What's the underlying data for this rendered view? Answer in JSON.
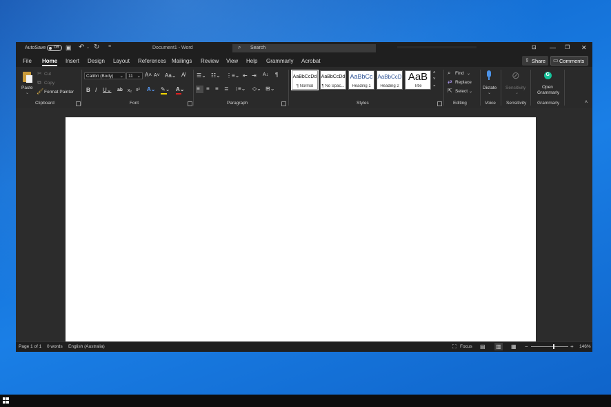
{
  "titlebar": {
    "autosave_label": "AutoSave",
    "autosave_state": "Off",
    "doc_title": "Document1 - Word",
    "search_placeholder": "Search"
  },
  "tabs": [
    "File",
    "Home",
    "Insert",
    "Design",
    "Layout",
    "References",
    "Mailings",
    "Review",
    "View",
    "Help",
    "Grammarly",
    "Acrobat"
  ],
  "active_tab": "Home",
  "share_label": "Share",
  "comments_label": "Comments",
  "clipboard": {
    "paste": "Paste",
    "cut": "Cut",
    "copy": "Copy",
    "format_painter": "Format Painter",
    "group": "Clipboard"
  },
  "font": {
    "family": "Calibri (Body)",
    "size": "11",
    "group": "Font"
  },
  "paragraph": {
    "group": "Paragraph"
  },
  "styles": {
    "group": "Styles",
    "items": [
      {
        "sample": "AaBbCcDd",
        "name": "¶ Normal"
      },
      {
        "sample": "AaBbCcDd",
        "name": "¶ No Spac..."
      },
      {
        "sample": "AaBbCc",
        "name": "Heading 1"
      },
      {
        "sample": "AaBbCcD",
        "name": "Heading 2"
      },
      {
        "sample": "AaB",
        "name": "Title"
      }
    ]
  },
  "editing": {
    "find": "Find",
    "replace": "Replace",
    "select": "Select",
    "group": "Editing"
  },
  "voice": {
    "dictate": "Dictate",
    "group": "Voice"
  },
  "sensitivity": {
    "label": "Sensitivity",
    "group": "Sensitivity"
  },
  "grammarly": {
    "open_line1": "Open",
    "open_line2": "Grammarly",
    "group": "Grammarly"
  },
  "statusbar": {
    "page": "Page 1 of 1",
    "words": "0 words",
    "language": "English (Australia)",
    "focus": "Focus",
    "zoom": "146%",
    "zoom_fraction": 0.62
  },
  "colors": {
    "accent_highlight": "#f5d800",
    "accent_font": "#e02020",
    "heading_blue": "#2f5496",
    "grammarly_green": "#15c39a"
  }
}
